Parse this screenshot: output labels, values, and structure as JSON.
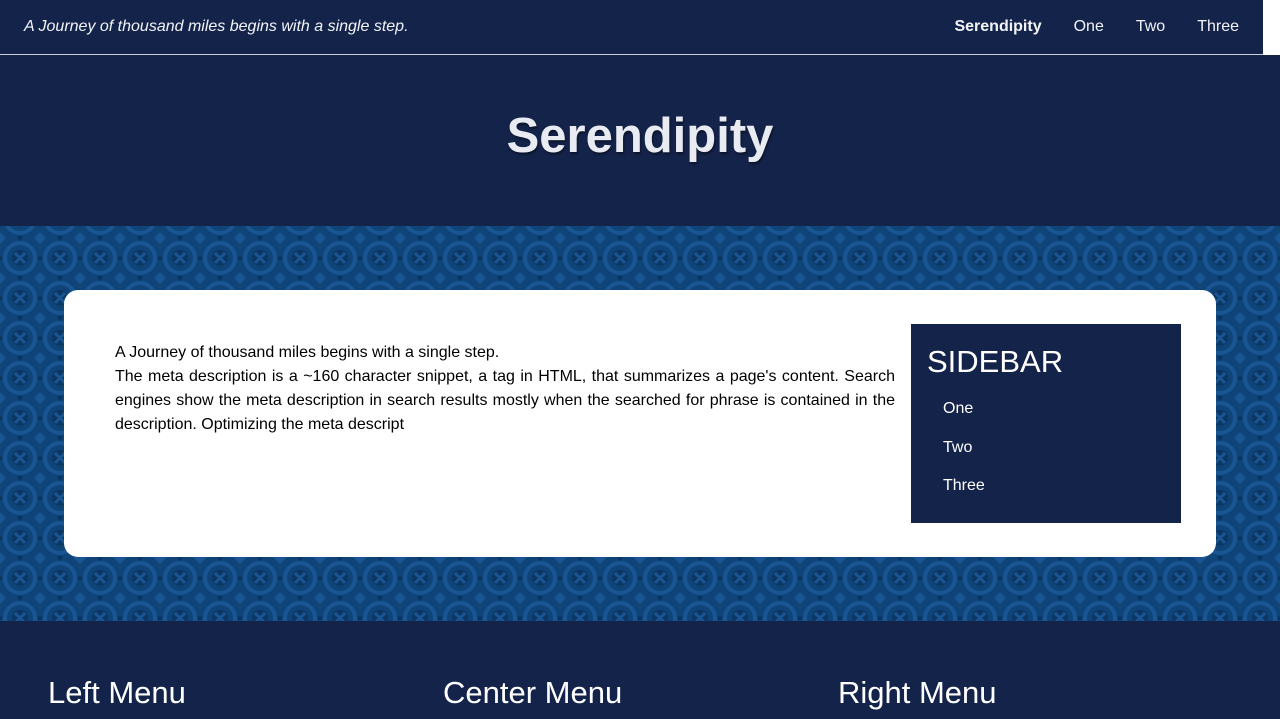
{
  "header": {
    "tagline": "A Journey of thousand miles begins with a single step.",
    "nav": {
      "brand": "Serendipity",
      "items": [
        "One",
        "Two",
        "Three"
      ]
    }
  },
  "hero": {
    "title": "Serendipity"
  },
  "main": {
    "lead": "A Journey of thousand miles begins with a single step.",
    "body": "The meta description is a ~160 character snippet, a tag in HTML, that summarizes a page's content. Search engines show the meta description in search results mostly when the searched for phrase is contained in the description. Optimizing the meta descript"
  },
  "sidebar": {
    "title": "SIDEBAR",
    "items": [
      "One",
      "Two",
      "Three"
    ]
  },
  "footer": {
    "left": "Left Menu",
    "center": "Center Menu",
    "right": "Right Menu"
  },
  "colors": {
    "navy": "#14234a",
    "pattern": "#0f4478",
    "white": "#ffffff"
  }
}
